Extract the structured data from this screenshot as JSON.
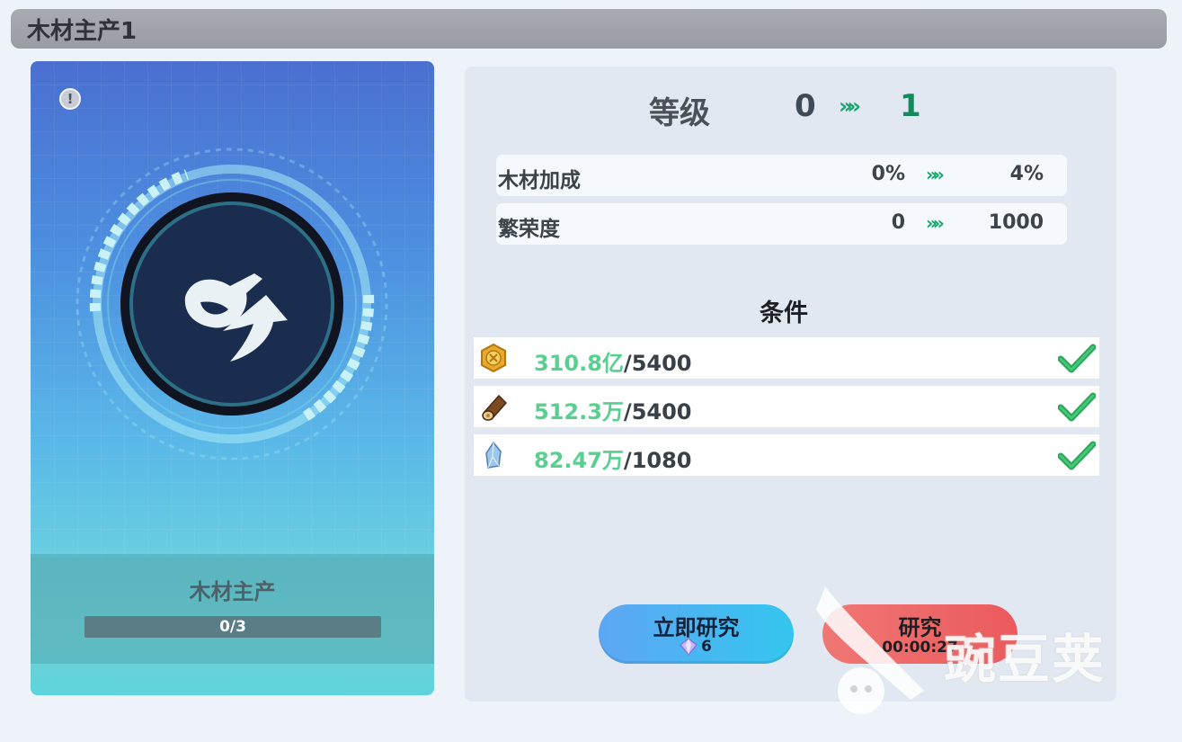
{
  "header": {
    "title": "木材主产1"
  },
  "card": {
    "name": "木材主产",
    "progress_text": "0/3",
    "progress": 0
  },
  "level": {
    "label": "等级",
    "from": "0",
    "arrow": "»»",
    "to": "1"
  },
  "stats": [
    {
      "name": "木材加成",
      "from": "0%",
      "to": "4%"
    },
    {
      "name": "繁荣度",
      "from": "0",
      "to": "1000"
    }
  ],
  "conditions": {
    "title": "条件",
    "items": [
      {
        "icon": "gold-coin-icon",
        "have": "310.8亿",
        "need": "/5400",
        "met": true
      },
      {
        "icon": "wood-log-icon",
        "have": "512.3万",
        "need": "/5400",
        "met": true
      },
      {
        "icon": "crystal-icon",
        "have": "82.47万",
        "need": "/1080",
        "met": true
      }
    ]
  },
  "buttons": {
    "instant": {
      "label": "立即研究",
      "cost": "6",
      "cost_icon": "diamond-icon"
    },
    "research": {
      "label": "研究",
      "time": "00:00:27"
    }
  },
  "watermark": {
    "text": "豌豆荚"
  },
  "colors": {
    "accent_green": "#17a66b",
    "have_green": "#58d08f",
    "instant_button": "#33c6ee",
    "research_button": "#eb5a5d"
  }
}
